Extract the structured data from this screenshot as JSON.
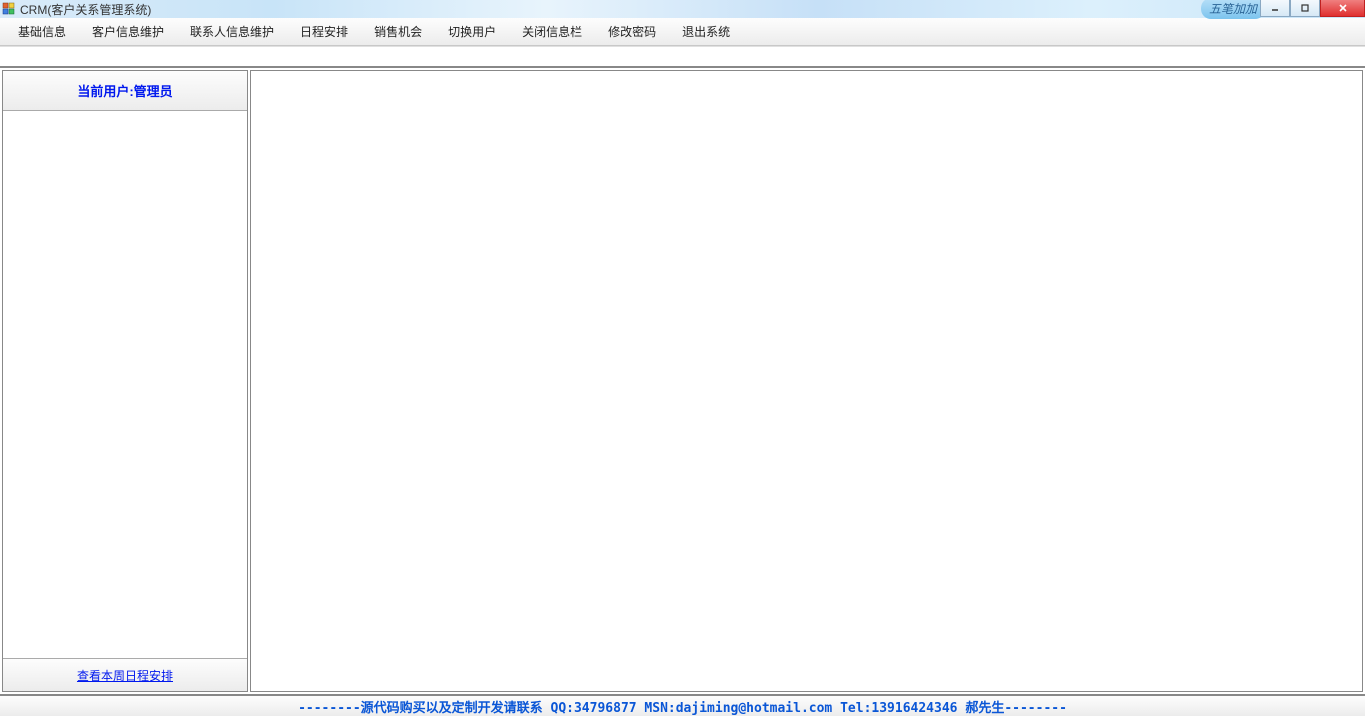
{
  "window": {
    "title": "CRM(客户关系管理系统)",
    "overlay_badge": "五笔加加"
  },
  "menu": {
    "items": [
      "基础信息",
      "客户信息维护",
      "联系人信息维护",
      "日程安排",
      "销售机会",
      "切换用户",
      "关闭信息栏",
      "修改密码",
      "退出系统"
    ]
  },
  "sidebar": {
    "current_user_label": "当前用户:管理员",
    "footer_link": "查看本周日程安排"
  },
  "statusbar": {
    "text": "--------源代码购买以及定制开发请联系 QQ:34796877 MSN:dajiming@hotmail.com Tel:13916424346 郝先生--------"
  }
}
